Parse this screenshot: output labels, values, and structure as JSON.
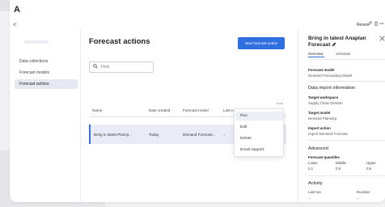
{
  "app": {
    "logo_glyph": "A",
    "back_glyph": "<"
  },
  "toolbar": {
    "reset_label": "Reset",
    "pencil_icon": "pencil",
    "trash_icon": "trash",
    "more_icon": "more"
  },
  "sidebar": {
    "items": [
      {
        "label": "Data collections",
        "active": false
      },
      {
        "label": "Forecast models",
        "active": false
      },
      {
        "label": "Forecast actions",
        "active": true
      }
    ]
  },
  "main": {
    "title": "Forecast actions",
    "new_button_label": "New forecast action",
    "search": {
      "placeholder": "Find",
      "icon": "search-icon"
    },
    "table": {
      "columns": [
        "Name",
        "Date created",
        "Forecast model",
        "Last run",
        "Schedule status"
      ],
      "rows": [
        {
          "name": "Bring in latest PlanIQ...",
          "date_created": "Today",
          "model": "Demand Forecast...",
          "last_run": "--",
          "schedule_status": "--"
        }
      ]
    },
    "row_menu": {
      "items": [
        "Run",
        "Edit",
        "Delete",
        "Email support"
      ],
      "hovered": "Run"
    }
  },
  "panel": {
    "title": "Bring in latest Anaplan Forecast",
    "tabs": [
      "Overview",
      "Schedule"
    ],
    "active_tab": "Overview",
    "forecast_model_label": "Forecast model",
    "forecast_model_value": "Demand Forecasting Model",
    "data_import_heading": "Data import information",
    "target_workspace_label": "Target workspace",
    "target_workspace_value": "Supply Chain Division",
    "target_model_label": "Target model",
    "target_model_value": "Demand Planning",
    "import_action_label": "Import action",
    "import_action_value": "Import Demand Forecast",
    "advanced_heading": "Advanced",
    "quantiles_label": "Forecast quantiles",
    "quantiles": {
      "headers": [
        "Lower",
        "Middle",
        "Upper"
      ],
      "values": [
        "0.1",
        "0.5",
        "0.9"
      ]
    },
    "activity_heading": "Activity",
    "activity_columns": [
      "Last run",
      "Duration"
    ],
    "activity_values": [
      "--",
      "--"
    ]
  },
  "colors": {
    "accent": "#2f6fe0",
    "selected_row": "#e9ecf7",
    "sidebar_active": "#e6e8f2"
  }
}
